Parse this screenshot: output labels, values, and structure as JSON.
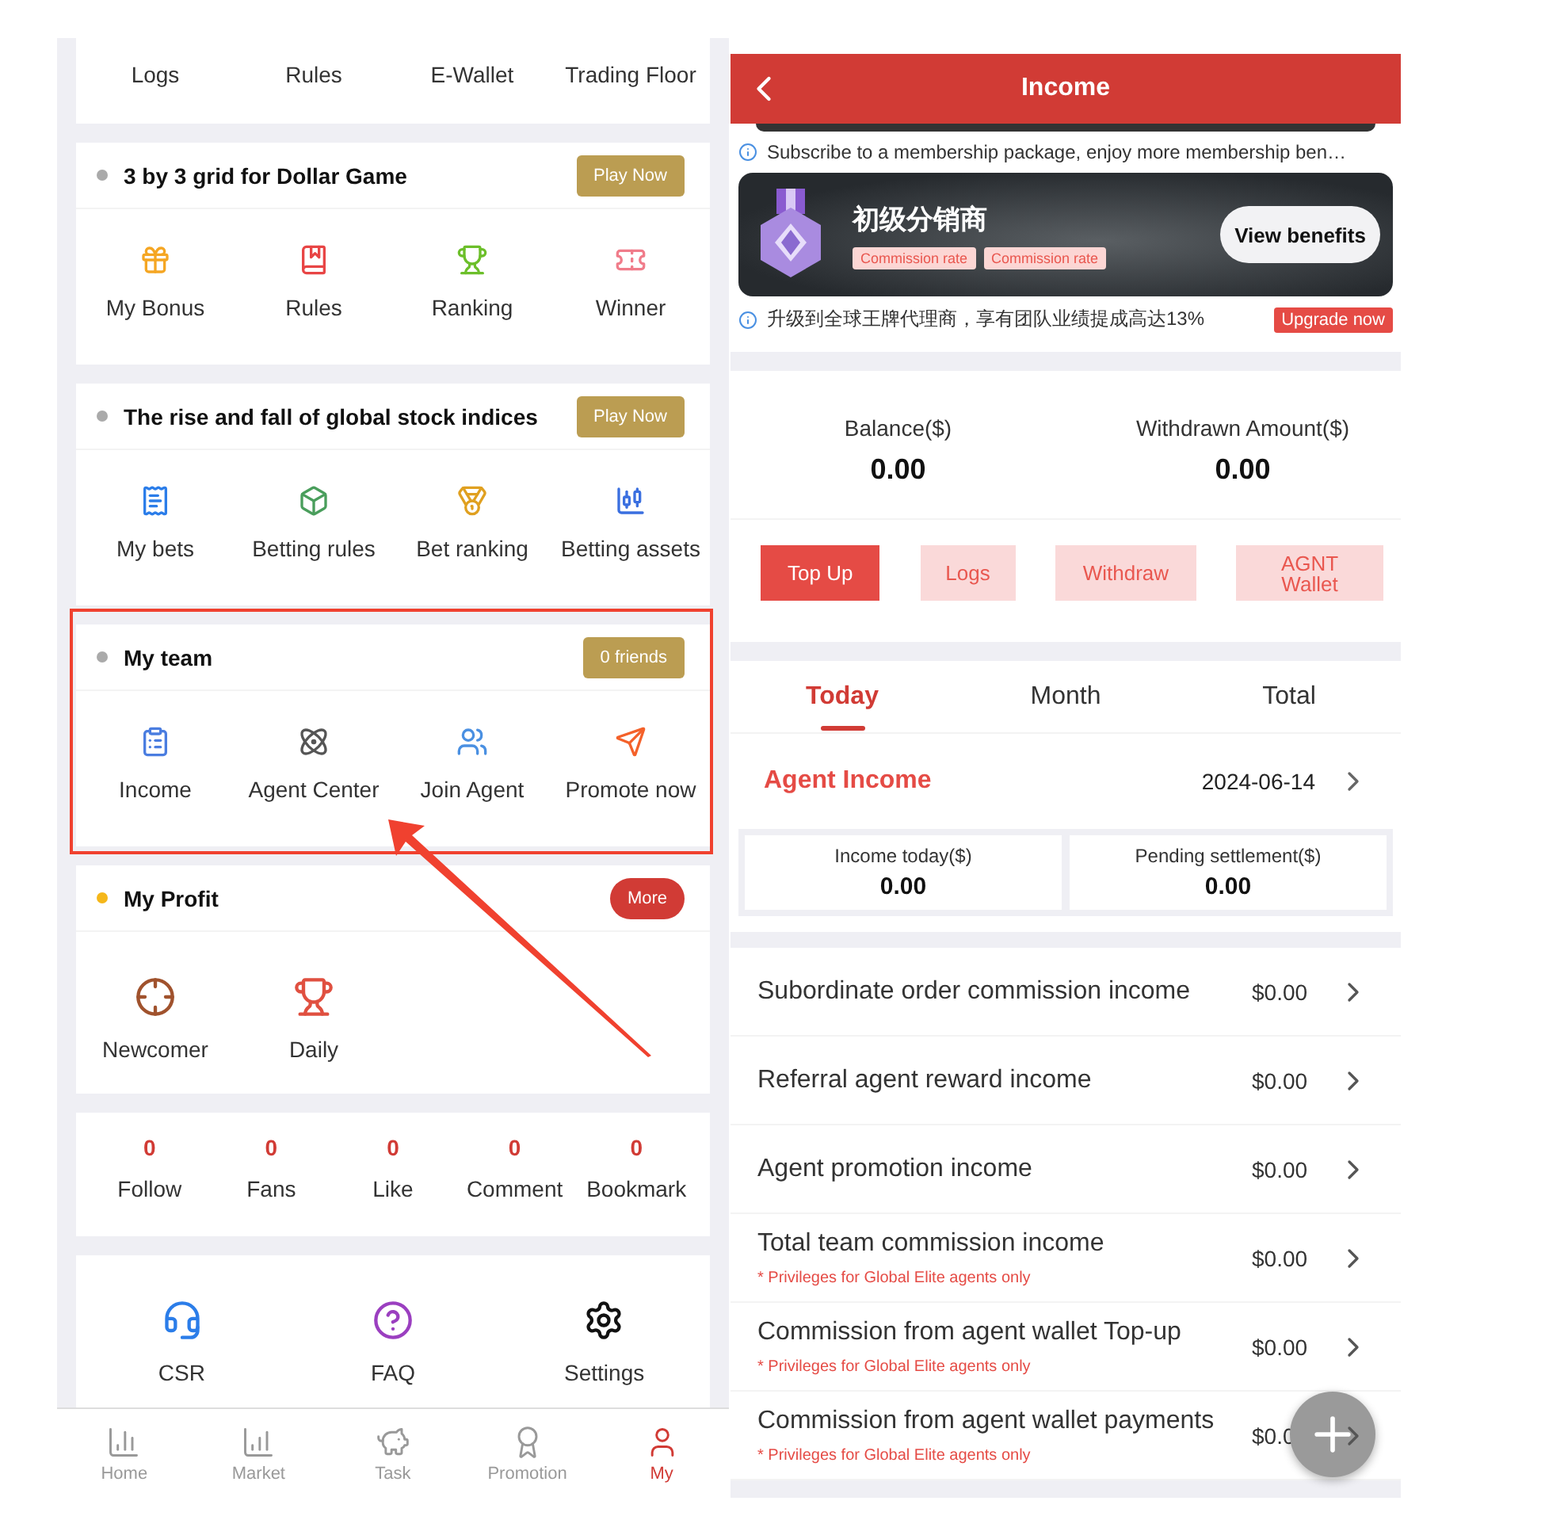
{
  "left_panel": {
    "quick_links": [
      "Logs",
      "Rules",
      "E-Wallet",
      "Trading Floor"
    ],
    "sections": [
      {
        "title": "3 by 3 grid for Dollar Game",
        "color": "#aaaaaa",
        "highlighted": false,
        "action": {
          "label": "Play Now",
          "kind": "gold"
        },
        "items": [
          {
            "label": "My Bonus"
          },
          {
            "label": "Rules"
          },
          {
            "label": "Ranking"
          },
          {
            "label": "Winner"
          }
        ]
      },
      {
        "title": "The rise and fall of global stock indices",
        "color": "#aaaaaa",
        "highlighted": false,
        "action": {
          "label": "Play Now",
          "kind": "gold"
        },
        "items": [
          {
            "label": "My bets"
          },
          {
            "label": "Betting rules"
          },
          {
            "label": "Bet ranking"
          },
          {
            "label": "Betting assets"
          }
        ]
      },
      {
        "title": "My team",
        "color": "#aaaaaa",
        "highlighted": true,
        "action": {
          "label": "0 friends",
          "kind": "gold"
        },
        "items": [
          {
            "label": "Income"
          },
          {
            "label": "Agent Center"
          },
          {
            "label": "Join Agent"
          },
          {
            "label": "Promote now"
          }
        ]
      },
      {
        "title": "My Profit",
        "color": "#f5b71a",
        "highlighted": false,
        "action": {
          "label": "More",
          "kind": "pill"
        },
        "items": [
          {
            "label": "Newcomer"
          },
          {
            "label": "Daily"
          }
        ]
      }
    ],
    "stats": [
      {
        "value": "0",
        "label": "Follow"
      },
      {
        "value": "0",
        "label": "Fans"
      },
      {
        "value": "0",
        "label": "Like"
      },
      {
        "value": "0",
        "label": "Comment"
      },
      {
        "value": "0",
        "label": "Bookmark"
      }
    ],
    "services": [
      {
        "label": "CSR"
      },
      {
        "label": "FAQ"
      },
      {
        "label": "Settings"
      }
    ],
    "bottom_nav": [
      {
        "label": "Home",
        "selected": false
      },
      {
        "label": "Market",
        "selected": false
      },
      {
        "label": "Task",
        "selected": false
      },
      {
        "label": "Promotion",
        "selected": false
      },
      {
        "label": "My",
        "selected": true
      }
    ]
  },
  "right_panel": {
    "header": {
      "title": "Income"
    },
    "notice": "Subscribe to a membership package, enjoy more membership ben…",
    "banner": {
      "title": "初级分销商",
      "tags": [
        "Commission rate",
        "Commission rate"
      ],
      "button": "View benefits"
    },
    "upgrade": {
      "text": "升级到全球王牌代理商，享有团队业绩提成高达13%",
      "button": "Upgrade now"
    },
    "balances": [
      {
        "label": "Balance($)",
        "value": "0.00"
      },
      {
        "label": "Withdrawn Amount($)",
        "value": "0.00"
      }
    ],
    "actions": [
      {
        "label": "Top Up",
        "kind": "primary"
      },
      {
        "label": "Logs",
        "kind": "secondary"
      },
      {
        "label": "Withdraw",
        "kind": "secondary"
      },
      {
        "label": "AGNT Wallet",
        "kind": "secondary"
      }
    ],
    "period_tabs": [
      {
        "label": "Today",
        "selected": true
      },
      {
        "label": "Month",
        "selected": false
      },
      {
        "label": "Total",
        "selected": false
      }
    ],
    "agent_income": {
      "title": "Agent Income",
      "date": "2024-06-14"
    },
    "stats": [
      {
        "label": "Income today($)",
        "value": "0.00"
      },
      {
        "label": "Pending settlement($)",
        "value": "0.00"
      }
    ],
    "income_rows": [
      {
        "title": "Subordinate order commission income",
        "value": "$0.00"
      },
      {
        "title": "Referral agent reward income",
        "value": "$0.00"
      },
      {
        "title": "Agent promotion income",
        "value": "$0.00"
      },
      {
        "title": "Total team commission income",
        "note": "* Privileges for Global Elite agents only",
        "value": "$0.00"
      },
      {
        "title": "Commission from agent wallet Top-up",
        "note": "* Privileges for Global Elite agents only",
        "value": "$0.00"
      },
      {
        "title": "Commission from agent wallet payments",
        "note": "* Privileges for Global Elite agents only",
        "value": "$0.0"
      }
    ]
  }
}
